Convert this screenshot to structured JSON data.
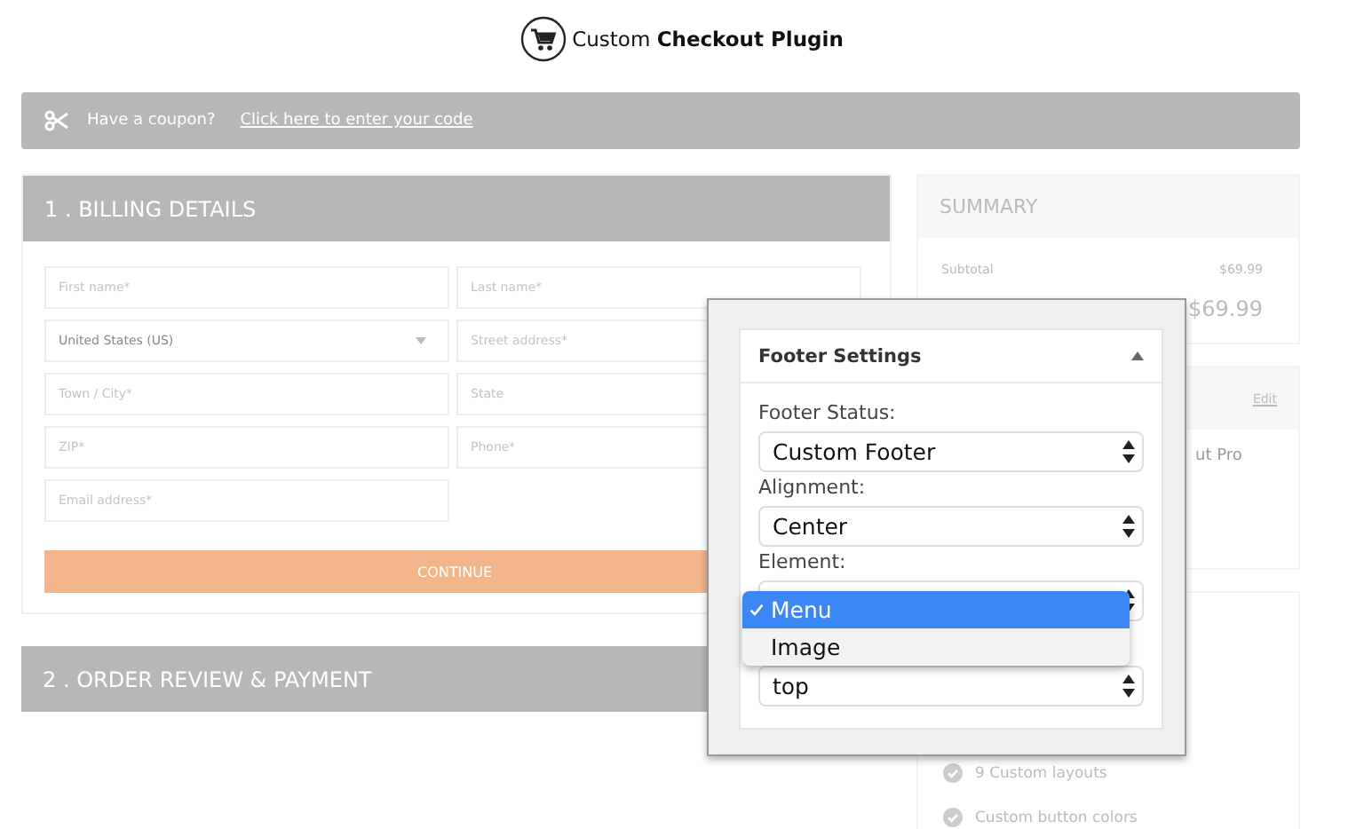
{
  "header": {
    "brand_light": "Custom",
    "brand_bold": "Checkout Plugin"
  },
  "coupon": {
    "text": "Have a coupon?",
    "link": "Click here to enter your code"
  },
  "billing": {
    "title": "1 . BILLING DETAILS",
    "fields": [
      {
        "kind": "text",
        "placeholder": "First name*"
      },
      {
        "kind": "text",
        "placeholder": "Last name*"
      },
      {
        "kind": "select",
        "value": "United States (US)"
      },
      {
        "kind": "text",
        "placeholder": "Street address*"
      },
      {
        "kind": "text",
        "placeholder": "Town / City*"
      },
      {
        "kind": "text",
        "placeholder": "State"
      },
      {
        "kind": "text",
        "placeholder": "ZIP*"
      },
      {
        "kind": "text",
        "placeholder": "Phone*"
      },
      {
        "kind": "text",
        "placeholder": "Email address*"
      }
    ],
    "continue": "CONTINUE"
  },
  "order_review": {
    "title": "2 . ORDER REVIEW & PAYMENT"
  },
  "summary": {
    "title": "SUMMARY",
    "subtotal_label": "Subtotal",
    "subtotal": "$69.99",
    "total": "$69.99",
    "edit": "Edit",
    "product": "ut Pro",
    "features": [
      "9 Custom layouts",
      "Custom button colors"
    ]
  },
  "footer_settings": {
    "title": "Footer Settings",
    "expanded": true,
    "fields": [
      {
        "label": "Footer Status:",
        "value": "Custom Footer"
      },
      {
        "label": "Alignment:",
        "value": "Center"
      },
      {
        "label": "Element:"
      },
      {
        "value": "top"
      }
    ],
    "dropdown": [
      {
        "label": "Menu",
        "selected": true
      },
      {
        "label": "Image",
        "selected": false
      }
    ]
  }
}
